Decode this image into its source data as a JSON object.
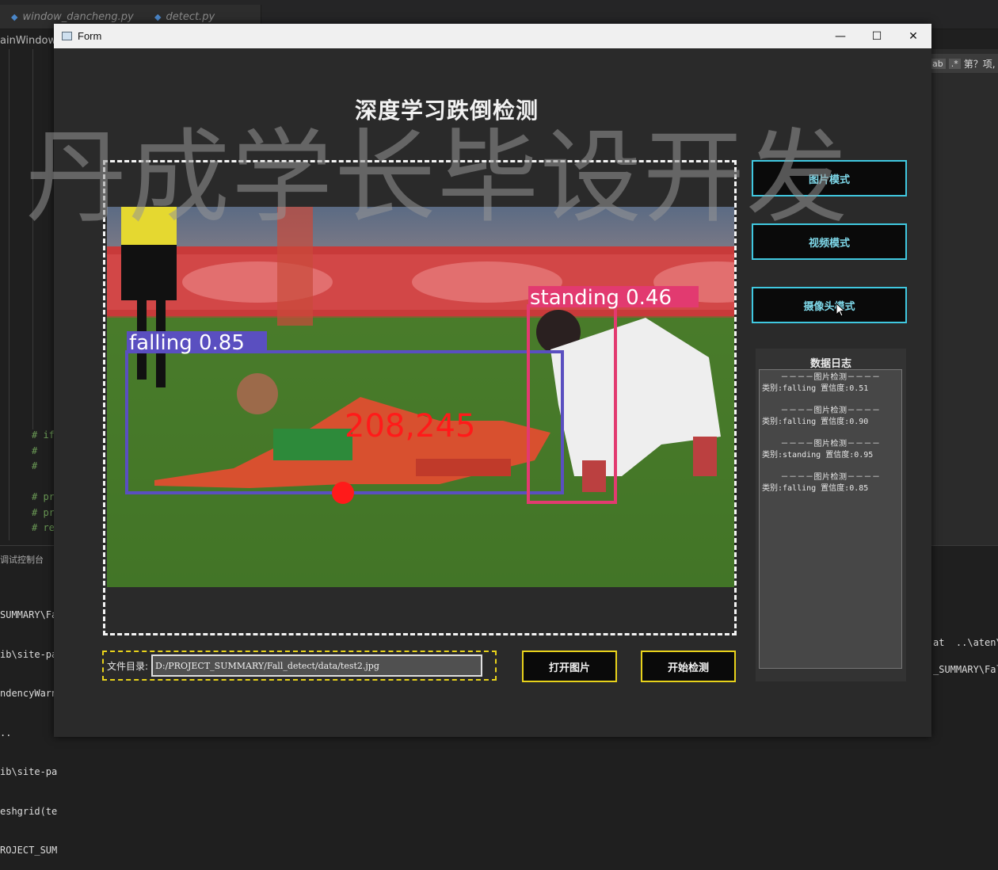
{
  "ide": {
    "tabs": [
      "window_dancheng.py",
      "detect.py"
    ],
    "breadcrumb": "ainWindow ❯",
    "code_comments": [
      "# if",
      "#",
      "#",
      "",
      "# pr",
      "# pr",
      "# re"
    ],
    "terminal_title": "调试控制台",
    "terminal_lines": [
      "SUMMARY\\Fa",
      "ib\\site-pa",
      "ndencyWarn",
      "..",
      "ib\\site-pa",
      "eshgrid(te",
      "ROJECT_SUM"
    ],
    "terminal_right_1": "at  ..\\aten\\",
    "terminal_right_2": "_SUMMARY\\Fal",
    "find_options": "ab",
    "find_regex": ".*",
    "find_result": "第？项,"
  },
  "window": {
    "title": "Form",
    "minimize": "—",
    "maximize": "☐",
    "close": "✕"
  },
  "watermark": "丹成学长毕设开发",
  "main_title": "深度学习跌倒检测",
  "detections": [
    {
      "label": "falling 0.85",
      "color": "#5a4fc0"
    },
    {
      "label": "standing 0.46",
      "color": "#e23a70"
    }
  ],
  "coord_text": "208,245",
  "modes": {
    "image": "图片模式",
    "video": "视频模式",
    "camera": "摄像头模式"
  },
  "log": {
    "title": "数据日志",
    "entries": [
      {
        "head": "－－－－图片检测－－－－",
        "line": "类别:falling  置信度:0.51"
      },
      {
        "head": "－－－－图片检测－－－－",
        "line": "类别:falling  置信度:0.90"
      },
      {
        "head": "－－－－图片检测－－－－",
        "line": "类别:standing  置信度:0.95"
      },
      {
        "head": "－－－－图片检测－－－－",
        "line": "类别:falling  置信度:0.85"
      }
    ]
  },
  "file": {
    "label": "文件目录:",
    "path": "D:/PROJECT_SUMMARY/Fall_detect/data/test2.jpg"
  },
  "buttons": {
    "open": "打开图片",
    "detect": "开始检测"
  },
  "colors": {
    "accent_cyan": "#40c8e0",
    "accent_yellow": "#e8d21b",
    "falling_box": "#5a4fc0",
    "standing_box": "#e23a70",
    "marker_red": "#ff1a1a"
  }
}
